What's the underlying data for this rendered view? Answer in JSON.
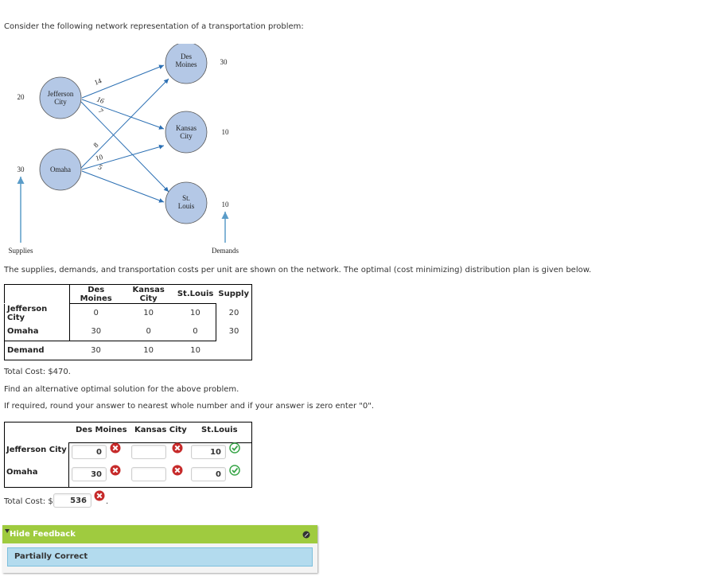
{
  "intro": "Consider the following network representation of a transportation problem:",
  "network": {
    "sources": [
      {
        "name_line1": "Jefferson",
        "name_line2": "City",
        "supply": "20"
      },
      {
        "name_line1": "Omaha",
        "name_line2": "",
        "supply": "30"
      }
    ],
    "destinations": [
      {
        "name_line1": "Des",
        "name_line2": "Moines",
        "demand": "30"
      },
      {
        "name_line1": "Kansas",
        "name_line2": "City",
        "demand": "10"
      },
      {
        "name_line1": "St.",
        "name_line2": "Louis",
        "demand": "10"
      }
    ],
    "costs": {
      "jefferson_desmoines": "14",
      "jefferson_kansascity": "16",
      "jefferson_stlouis": "7",
      "omaha_desmoines": "8",
      "omaha_kansascity": "10",
      "omaha_stlouis": "5"
    },
    "supplies_label": "Supplies",
    "demands_label": "Demands",
    "node_fill": "#b4c8e6",
    "arrow_color": "#2b6fb3"
  },
  "description": "The supplies, demands, and transportation costs per unit are shown on the network. The optimal (cost minimizing) distribution plan is given below.",
  "plan_table": {
    "headers": [
      "Des Moines",
      "Kansas City",
      "St.Louis",
      "Supply"
    ],
    "rows": [
      {
        "label": "Jefferson City",
        "values": [
          "0",
          "10",
          "10"
        ],
        "supply": "20"
      },
      {
        "label": "Omaha",
        "values": [
          "30",
          "0",
          "0"
        ],
        "supply": "30"
      }
    ],
    "demand_row": {
      "label": "Demand",
      "values": [
        "30",
        "10",
        "10"
      ]
    }
  },
  "total_cost_text": "Total Cost: $470.",
  "find_text": "Find an alternative optimal solution for the above problem.",
  "round_text": "If required, round your answer to nearest whole number and if your answer is zero enter \"0\".",
  "answer_table": {
    "headers": [
      "Des Moines",
      "Kansas City",
      "St.Louis"
    ],
    "rows": [
      {
        "label": "Jefferson City",
        "cells": [
          {
            "value": "0",
            "status": "incorrect"
          },
          {
            "value": "",
            "status": "incorrect"
          },
          {
            "value": "10",
            "status": "correct"
          }
        ]
      },
      {
        "label": "Omaha",
        "cells": [
          {
            "value": "30",
            "status": "incorrect"
          },
          {
            "value": "",
            "status": "incorrect"
          },
          {
            "value": "0",
            "status": "correct"
          }
        ]
      }
    ]
  },
  "total_cost_answer": {
    "label": "Total Cost: $",
    "value": "536",
    "status": "incorrect",
    "suffix": "."
  },
  "feedback": {
    "toggle_label": "Hide Feedback",
    "status": "Partially Correct",
    "bar_color": "#9fcb3f",
    "box_color": "#b3dbee"
  }
}
